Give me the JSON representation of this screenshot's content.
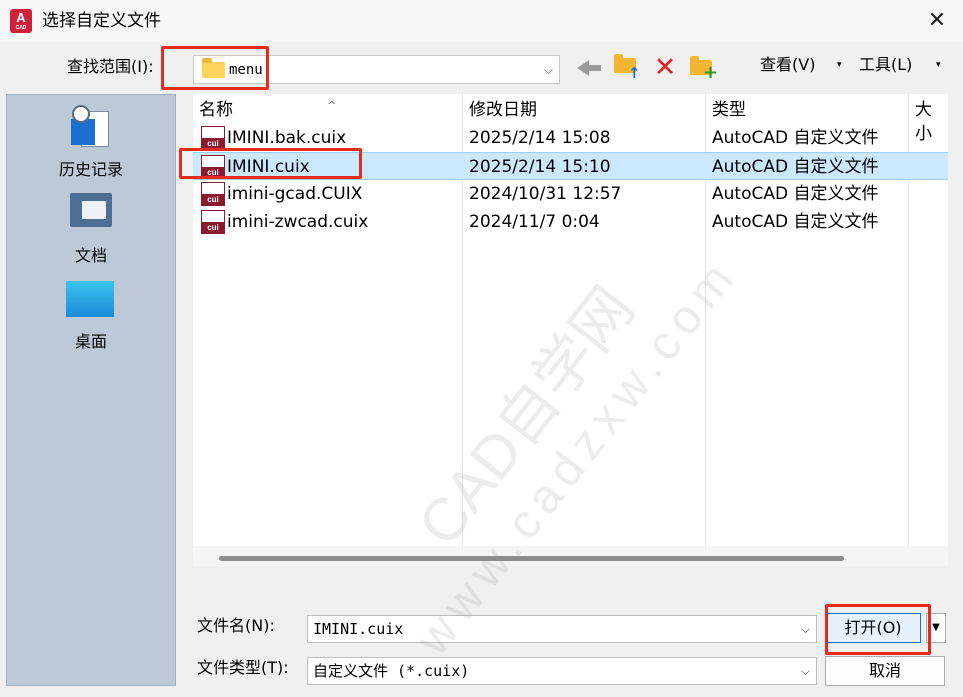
{
  "window": {
    "icon_text": "A",
    "icon_subtext": "CAD",
    "title": "选择自定义文件",
    "close_glyph": "✕"
  },
  "toolbar": {
    "look_in_label": "查找范围(I):",
    "look_in_value": "menu",
    "view_label": "查看(V)",
    "tools_label": "工具(L)"
  },
  "places": [
    {
      "label": "历史记录",
      "icon": "history-icon"
    },
    {
      "label": "文档",
      "icon": "documents-folder-icon"
    },
    {
      "label": "桌面",
      "icon": "desktop-icon"
    }
  ],
  "columns": [
    "名称",
    "修改日期",
    "类型",
    "大小"
  ],
  "files": [
    {
      "name": "IMINI.bak.cuix",
      "date": "2025/2/14 15:08",
      "type": "AutoCAD 自定义文件",
      "selected": false
    },
    {
      "name": "IMINI.cuix",
      "date": "2025/2/14 15:10",
      "type": "AutoCAD 自定义文件",
      "selected": true
    },
    {
      "name": "imini-gcad.CUIX",
      "date": "2024/10/31 12:57",
      "type": "AutoCAD 自定义文件",
      "selected": false
    },
    {
      "name": "imini-zwcad.cuix",
      "date": "2024/11/7 0:04",
      "type": "AutoCAD 自定义文件",
      "selected": false
    }
  ],
  "file_icon_text": "cui",
  "filename": {
    "label": "文件名(N):",
    "value": "IMINI.cuix"
  },
  "filetype": {
    "label": "文件类型(T):",
    "value": "自定义文件 (*.cuix)"
  },
  "buttons": {
    "open": "打开(O)",
    "cancel": "取消"
  },
  "watermark": {
    "line1": "CAD自学网",
    "line2": "www.cadzxw.com"
  },
  "colors": {
    "accent": "#0078d7",
    "selection": "#cce8ff",
    "highlight_box": "#e62b1e",
    "places_bg": "#bdc9d6"
  }
}
